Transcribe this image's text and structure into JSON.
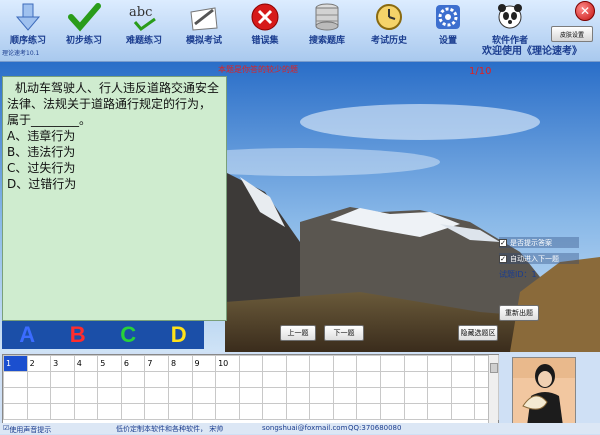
{
  "toolbar": {
    "items": [
      {
        "label": "顺序练习",
        "icon": "down-arrow-icon"
      },
      {
        "label": "初步练习",
        "icon": "checkmark-icon"
      },
      {
        "label": "难题练习",
        "icon": "abc-spelling-icon"
      },
      {
        "label": "模拟考试",
        "icon": "pencil-paper-icon"
      },
      {
        "label": "错误集",
        "icon": "red-x-icon"
      },
      {
        "label": "搜索题库",
        "icon": "database-icon"
      },
      {
        "label": "考试历史",
        "icon": "clock-icon"
      },
      {
        "label": "设置",
        "icon": "gear-icon"
      },
      {
        "label": "软件作者",
        "icon": "panda-icon"
      }
    ],
    "app_subtitle": "理论速考10.1",
    "welcome": "欢迎使用《理论速考》",
    "skin_button": "皮肤设置"
  },
  "notice": "本题是你答的较少的题",
  "progress": "1/10",
  "question": {
    "text": "机动车驾驶人、行人违反道路交通安全法律、法规关于道路通行规定的行为，属于________。",
    "options": [
      "A、违章行为",
      "B、违法行为",
      "C、过失行为",
      "D、过错行为"
    ]
  },
  "answers": [
    {
      "label": "A",
      "color": "#3b6cff"
    },
    {
      "label": "B",
      "color": "#ff2d2d"
    },
    {
      "label": "C",
      "color": "#28d23a"
    },
    {
      "label": "D",
      "color": "#ffe21a"
    }
  ],
  "buttons": {
    "prev": "上一题",
    "next": "下一题",
    "hide_area": "隐藏选题区",
    "restart": "重新出题"
  },
  "checkboxes": {
    "show_answer": "是否提示答案",
    "auto_next": "自动进入下一题"
  },
  "question_id": "试题ID：1",
  "grid": {
    "numbers": [
      "1",
      "2",
      "3",
      "4",
      "5",
      "6",
      "7",
      "8",
      "9",
      "10"
    ],
    "current": "1"
  },
  "status": {
    "sound": "使用声音提示",
    "ad": "低价定制本软件和各种软件， 宋帅",
    "email": "songshuai@foxmail.com",
    "qq": "QQ:370680080"
  }
}
